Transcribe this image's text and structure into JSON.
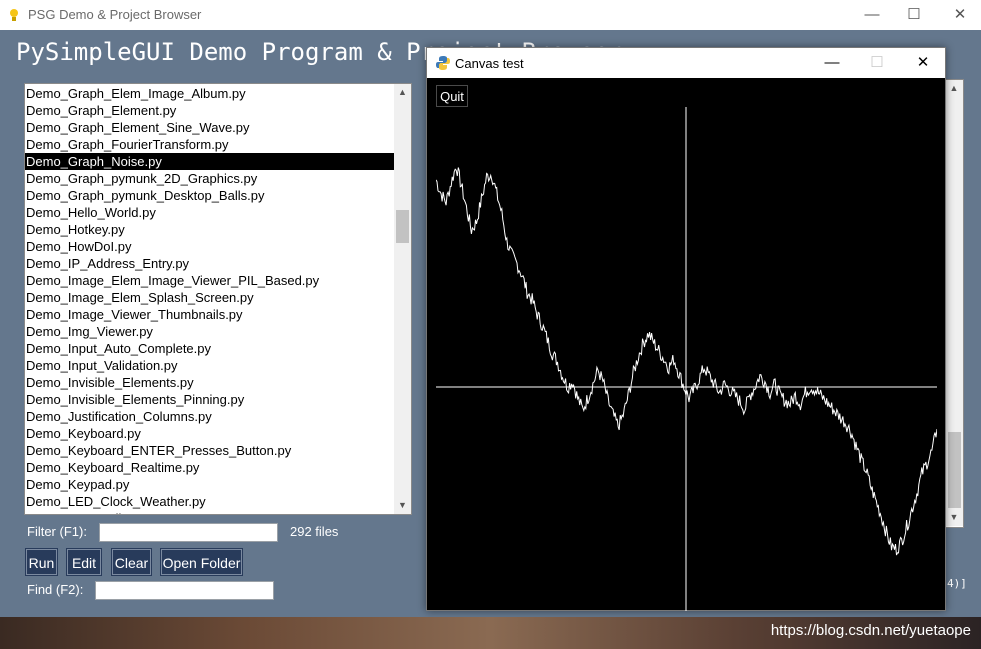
{
  "main_window": {
    "title": "PSG Demo & Project Browser",
    "heading": "PySimpleGUI Demo Program & Project Browser",
    "minimize": "—",
    "maximize": "☐",
    "close": "✕"
  },
  "file_list": {
    "items": [
      "Demo_Graph_Elem_Image_Album.py",
      "Demo_Graph_Element.py",
      "Demo_Graph_Element_Sine_Wave.py",
      "Demo_Graph_FourierTransform.py",
      "Demo_Graph_Noise.py",
      "Demo_Graph_pymunk_2D_Graphics.py",
      "Demo_Graph_pymunk_Desktop_Balls.py",
      "Demo_Hello_World.py",
      "Demo_Hotkey.py",
      "Demo_HowDoI.py",
      "Demo_IP_Address_Entry.py",
      "Demo_Image_Elem_Image_Viewer_PIL_Based.py",
      "Demo_Image_Elem_Splash_Screen.py",
      "Demo_Image_Viewer_Thumbnails.py",
      "Demo_Img_Viewer.py",
      "Demo_Input_Auto_Complete.py",
      "Demo_Input_Validation.py",
      "Demo_Invisible_Elements.py",
      "Demo_Invisible_Elements_Pinning.py",
      "Demo_Justification_Columns.py",
      "Demo_Keyboard.py",
      "Demo_Keyboard_ENTER_Presses_Button.py",
      "Demo_Keyboard_Realtime.py",
      "Demo_Keypad.py",
      "Demo_LED_Clock_Weather.py",
      "Demo_LED_Indicators.py"
    ],
    "selected": "Demo_Graph_Noise.py"
  },
  "filter": {
    "label": "Filter (F1):",
    "value": "",
    "file_count": "292 files"
  },
  "buttons": {
    "run": "Run",
    "edit": "Edit",
    "clear": "Clear",
    "open_folder": "Open Folder"
  },
  "find": {
    "label": "Find (F2):",
    "value": ""
  },
  "right_fragment": "4)]",
  "canvas_window": {
    "title": "Canvas test",
    "quit_label": "Quit",
    "minimize": "—",
    "maximize": "☐",
    "close": "✕"
  },
  "graph": {
    "line_color": "#ffffff",
    "background": "#000000",
    "noise_y": [
      0.74,
      0.69,
      0.66,
      0.73,
      0.79,
      0.72,
      0.64,
      0.56,
      0.59,
      0.67,
      0.75,
      0.76,
      0.69,
      0.62,
      0.52,
      0.47,
      0.44,
      0.4,
      0.34,
      0.31,
      0.26,
      0.22,
      0.17,
      0.12,
      0.09,
      0.04,
      0.0,
      0.02,
      -0.04,
      -0.08,
      -0.04,
      0.01,
      0.06,
      0.02,
      -0.05,
      -0.1,
      -0.14,
      -0.1,
      -0.03,
      0.05,
      0.11,
      0.16,
      0.19,
      0.16,
      0.13,
      0.1,
      0.07,
      0.1,
      0.05,
      0.0,
      -0.04,
      -0.01,
      0.03,
      0.07,
      0.04,
      0.01,
      -0.02,
      0.01,
      -0.01,
      -0.03,
      -0.05,
      -0.08,
      -0.03,
      0.0,
      0.04,
      0.02,
      -0.02,
      0.01,
      -0.03,
      -0.05,
      -0.06,
      -0.03,
      -0.06,
      -0.02,
      0.0,
      -0.01,
      -0.03,
      -0.05,
      -0.07,
      -0.09,
      -0.11,
      -0.13,
      -0.16,
      -0.21,
      -0.26,
      -0.3,
      -0.36,
      -0.41,
      -0.46,
      -0.52,
      -0.57,
      -0.58,
      -0.55,
      -0.5,
      -0.44,
      -0.38,
      -0.31,
      -0.27,
      -0.23,
      -0.15
    ],
    "x_axis_y": 0.0,
    "y_range": [
      -0.8,
      1.0
    ]
  },
  "watermark": "https://blog.csdn.net/yuetaope"
}
